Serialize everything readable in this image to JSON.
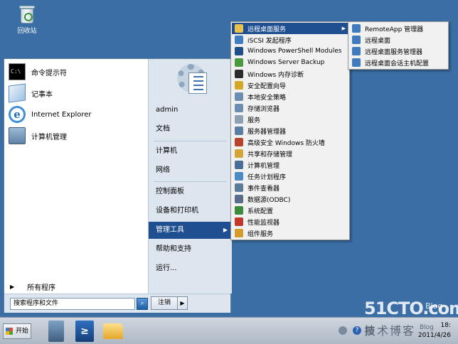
{
  "desktop": {
    "recycle_bin_label": "回收站"
  },
  "start_menu": {
    "pinned": [
      {
        "label": "命令提示符",
        "icon": "command-prompt-icon"
      },
      {
        "label": "记事本",
        "icon": "notepad-icon"
      },
      {
        "label": "Internet Explorer",
        "icon": "internet-explorer-icon"
      },
      {
        "label": "计算机管理",
        "icon": "computer-management-icon"
      }
    ],
    "all_programs": "所有程序",
    "search_placeholder": "搜索程序和文件",
    "user": "admin",
    "right_items": [
      {
        "label": "文档"
      },
      {
        "label": "计算机"
      },
      {
        "label": "网络"
      },
      {
        "label": "控制面板"
      },
      {
        "label": "设备和打印机"
      },
      {
        "label": "管理工具"
      },
      {
        "label": "帮助和支持"
      },
      {
        "label": "运行..."
      }
    ],
    "logoff_label": "注销"
  },
  "admin_tools": [
    {
      "label": "远程桌面服务",
      "color": "#e9c24d"
    },
    {
      "label": "iSCSI 发起程序",
      "color": "#3f7fc1"
    },
    {
      "label": "Windows PowerShell Modules",
      "color": "#1d4f8a"
    },
    {
      "label": "Windows Server Backup",
      "color": "#4c9a3f"
    },
    {
      "label": "Windows 内存诊断",
      "color": "#2c2c2c"
    },
    {
      "label": "安全配置向导",
      "color": "#d4a629"
    },
    {
      "label": "本地安全策略",
      "color": "#6d8db0"
    },
    {
      "label": "存储浏览器",
      "color": "#6d8db0"
    },
    {
      "label": "服务",
      "color": "#8ea2b6"
    },
    {
      "label": "服务器管理器",
      "color": "#5b7ea2"
    },
    {
      "label": "高级安全 Windows 防火墙",
      "color": "#b8442e"
    },
    {
      "label": "共享和存储管理",
      "color": "#d3a538"
    },
    {
      "label": "计算机管理",
      "color": "#4a6f97"
    },
    {
      "label": "任务计划程序",
      "color": "#4a8bc4"
    },
    {
      "label": "事件查看器",
      "color": "#5d7c9a"
    },
    {
      "label": "数据源(ODBC)",
      "color": "#5a6e8c"
    },
    {
      "label": "系统配置",
      "color": "#3c8a3c"
    },
    {
      "label": "性能监视器",
      "color": "#c0392b"
    },
    {
      "label": "组件服务",
      "color": "#d49a2a"
    }
  ],
  "remote_desktop_services": [
    {
      "label": "RemoteApp 管理器",
      "color": "#3e7bc0"
    },
    {
      "label": "远程桌面",
      "color": "#3e7bc0"
    },
    {
      "label": "远程桌面服务管理器",
      "color": "#3e7bc0"
    },
    {
      "label": "远程桌面会话主机配置",
      "color": "#3e7bc0"
    }
  ],
  "taskbar": {
    "start_label": "开始",
    "clock_time": "18:",
    "clock_date": "2011/4/26"
  },
  "watermark": {
    "line1": "51CTO.com",
    "line1b": "Blog",
    "line2": "技术博客",
    "line2b": "Blog"
  }
}
